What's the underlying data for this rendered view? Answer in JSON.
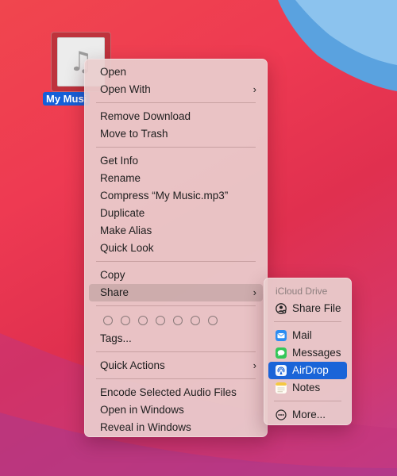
{
  "desktop": {
    "file_label": "My Musi",
    "file_icon": "music-note-icon"
  },
  "context_menu": {
    "group1": [
      "Open",
      "Open With"
    ],
    "group2": [
      "Remove Download",
      "Move to Trash"
    ],
    "group3": [
      "Get Info",
      "Rename",
      "Compress “My Music.mp3”",
      "Duplicate",
      "Make Alias",
      "Quick Look"
    ],
    "group4": [
      "Copy",
      "Share"
    ],
    "tags_label": "Tags...",
    "quick_actions": "Quick Actions",
    "group6": [
      "Encode Selected Audio Files",
      "Open in Windows",
      "Reveal in Windows"
    ],
    "highlighted": "Share"
  },
  "share_submenu": {
    "header": "iCloud Drive",
    "share_file": "Share File",
    "items": [
      "Mail",
      "Messages",
      "AirDrop",
      "Notes"
    ],
    "more": "More...",
    "highlighted": "AirDrop",
    "accent": "#1a64d8"
  },
  "colors": {
    "selection": "#1560d8",
    "menu_bg": "#e9cdcd"
  }
}
